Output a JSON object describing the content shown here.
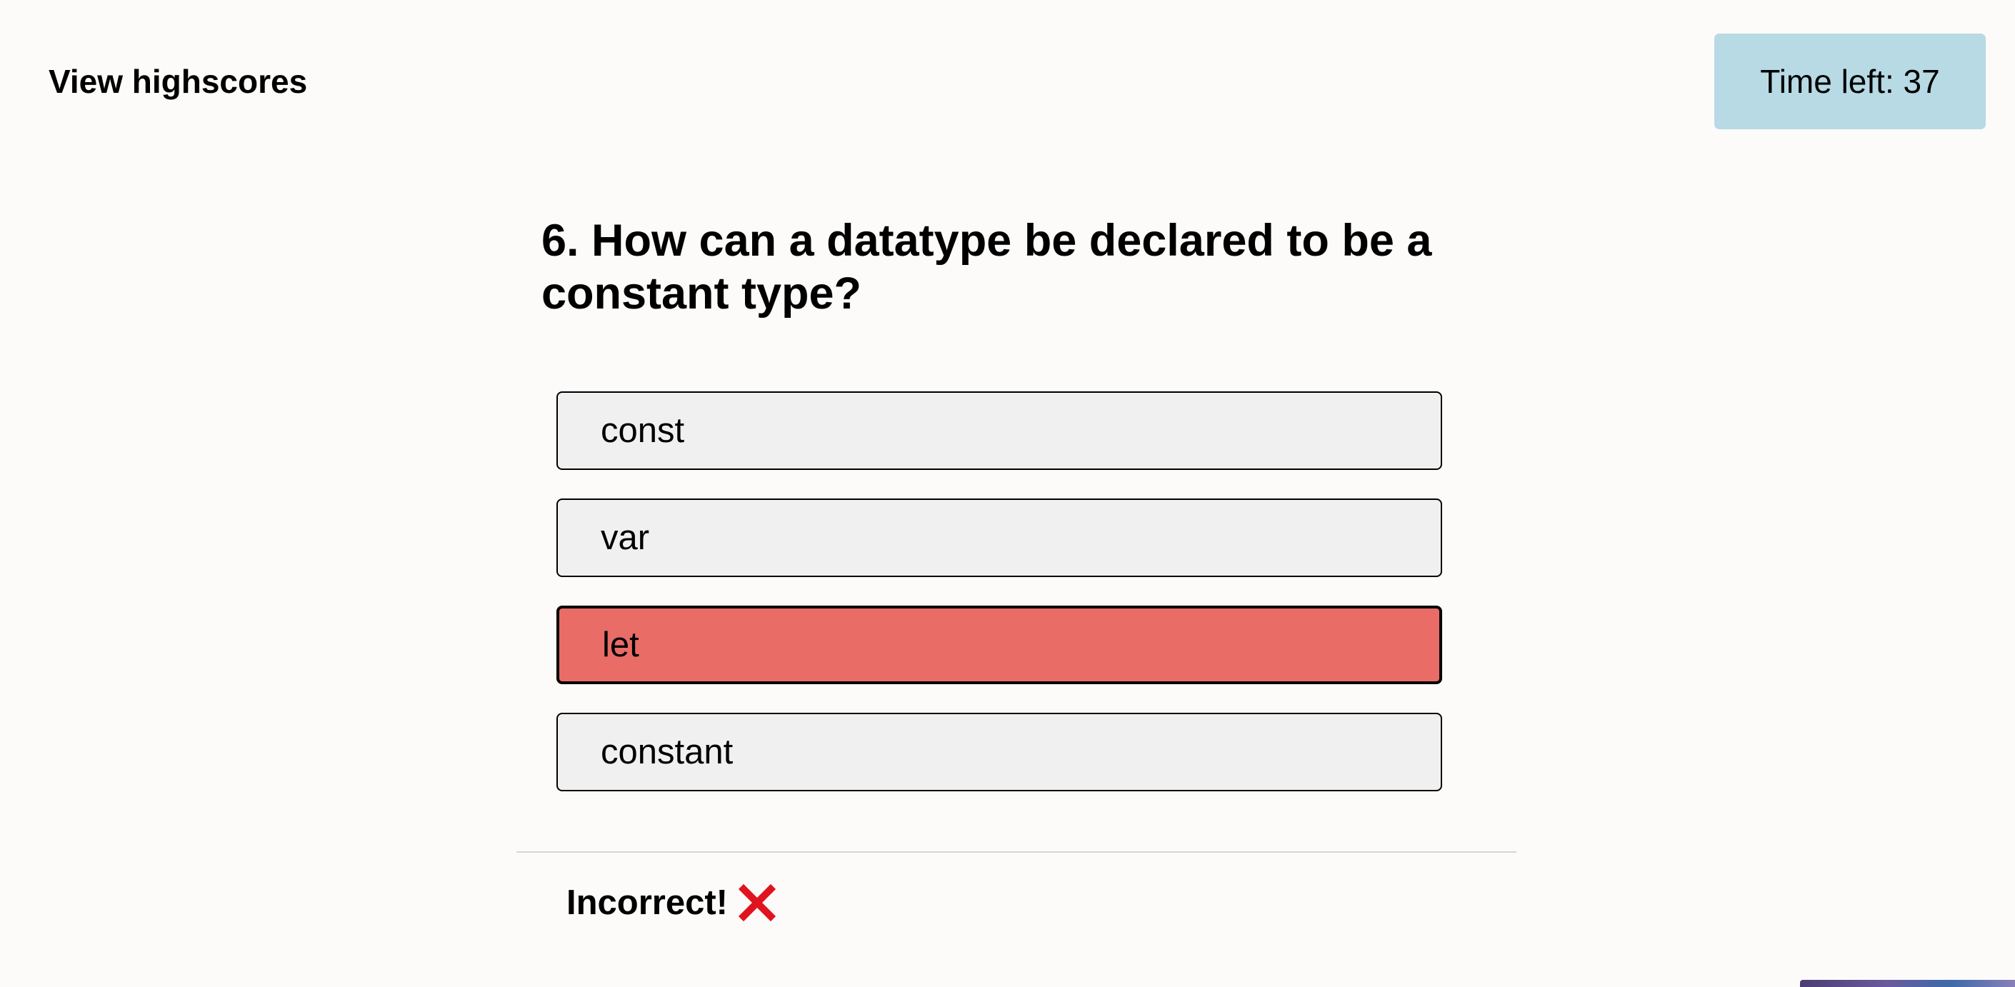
{
  "header": {
    "highscores_link": "View highscores",
    "timer_text": "Time left: 37"
  },
  "quiz": {
    "question": "6. How can a datatype be declared to be a constant type?",
    "answers": [
      {
        "label": "const",
        "state": "default"
      },
      {
        "label": "var",
        "state": "default"
      },
      {
        "label": "let",
        "state": "incorrect"
      },
      {
        "label": "constant",
        "state": "default"
      }
    ]
  },
  "feedback": {
    "text": "Incorrect!",
    "icon": "cross-mark-icon",
    "icon_color": "#e0141e"
  },
  "colors": {
    "background": "#fcfbf9",
    "timer_bg": "#b7dae5",
    "answer_bg": "#f0f0f0",
    "incorrect_bg": "#e96c67"
  }
}
